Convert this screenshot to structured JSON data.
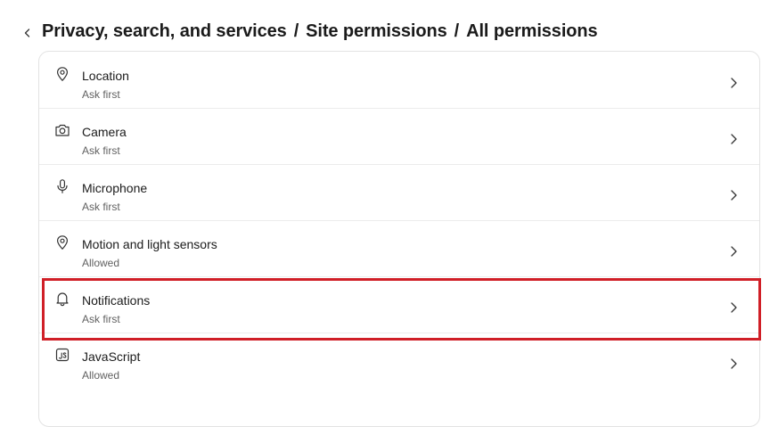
{
  "breadcrumb": {
    "items": [
      "Privacy, search, and services",
      "Site permissions",
      "All permissions"
    ],
    "separator": "/"
  },
  "permissions": [
    {
      "title": "Location",
      "status": "Ask first",
      "icon": "location-pin-icon"
    },
    {
      "title": "Camera",
      "status": "Ask first",
      "icon": "camera-icon"
    },
    {
      "title": "Microphone",
      "status": "Ask first",
      "icon": "microphone-icon"
    },
    {
      "title": "Motion and light sensors",
      "status": "Allowed",
      "icon": "location-pin-icon"
    },
    {
      "title": "Notifications",
      "status": "Ask first",
      "icon": "bell-icon"
    },
    {
      "title": "JavaScript",
      "status": "Allowed",
      "icon": "javascript-icon"
    }
  ],
  "colors": {
    "highlight": "#d01f27",
    "text": "#1b1b1b",
    "subtext": "#616161"
  }
}
